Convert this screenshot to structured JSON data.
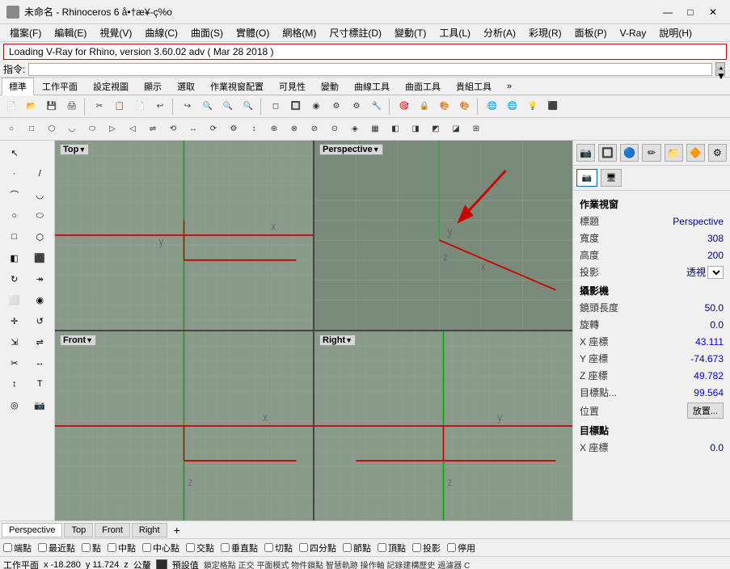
{
  "titlebar": {
    "title": "未命名 - Rhinoceros 6 å•†æ¥-ç%o",
    "icon": "rhino-icon",
    "minimize_label": "—",
    "maximize_label": "□",
    "close_label": "✕"
  },
  "menubar": {
    "items": [
      "檔案(F)",
      "編輯(E)",
      "視覺(V)",
      "曲線(C)",
      "曲面(S)",
      "實體(O)",
      "網格(M)",
      "尺寸標註(D)",
      "變動(T)",
      "工具(L)",
      "分析(A)",
      "彩現(R)",
      "面板(P)",
      "V-Ray",
      "說明(H)"
    ]
  },
  "notif_bar": {
    "text": "Loading V-Ray for Rhino, version 3.60.02 adv ( Mar 28 2018 )"
  },
  "cmdbar": {
    "label": "指令:",
    "placeholder": ""
  },
  "toolbar_tabs": {
    "items": [
      "標準",
      "工作平面",
      "設定視圖",
      "顯示",
      "選取",
      "作業視窗配置",
      "可見性",
      "變動",
      "曲線工具",
      "曲面工具",
      "貴組工具",
      "»"
    ]
  },
  "viewports": {
    "top_left": {
      "label": "Top",
      "view": "top"
    },
    "top_right": {
      "label": "Perspective",
      "view": "perspective"
    },
    "bot_left": {
      "label": "Front",
      "view": "front"
    },
    "bot_right": {
      "label": "Right",
      "view": "right"
    }
  },
  "right_panel": {
    "section_title": "作業視窗",
    "rows": [
      {
        "key": "標題",
        "val": "Perspective"
      },
      {
        "key": "寬度",
        "val": "308"
      },
      {
        "key": "高度",
        "val": "200"
      },
      {
        "key": "投影",
        "val": "透視"
      }
    ],
    "camera_section": "攝影機",
    "camera_rows": [
      {
        "key": "鏡頭長度",
        "val": "50.0"
      },
      {
        "key": "旋轉",
        "val": "0.0"
      },
      {
        "key": "X 座標",
        "val": "43.111"
      },
      {
        "key": "Y 座標",
        "val": "-74.673"
      },
      {
        "key": "Z 座標",
        "val": "49.782"
      },
      {
        "key": "目標點...",
        "val": "99.564"
      },
      {
        "key": "位置",
        "val": "放置..."
      }
    ],
    "target_section": "目標點",
    "target_rows": [
      {
        "key": "X 座標",
        "val": "0.0"
      }
    ]
  },
  "bottom_tabs": {
    "tabs": [
      "Perspective",
      "Top",
      "Front",
      "Right"
    ],
    "add_label": "+"
  },
  "statusbar": {
    "items": [
      "端點",
      "最近點",
      "點",
      "中點",
      "中心點",
      "交點",
      "垂直點",
      "切點",
      "四分點",
      "節點",
      "頂點",
      "投影",
      "停用"
    ]
  },
  "coordbar": {
    "workplane": "工作平面",
    "x": "-18.280",
    "y": "11.724",
    "z": "z",
    "unit": "公釐",
    "preset": "預設值",
    "info": "鎖定格點 正交 平面模式 物件鎖點 智慧軌跡 操作軸 記錄建構歷史 過濾器 C"
  }
}
